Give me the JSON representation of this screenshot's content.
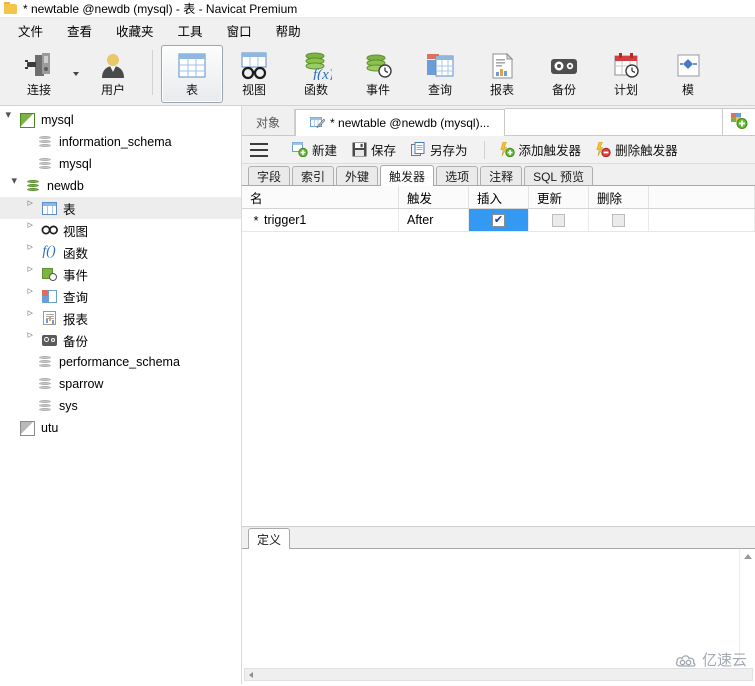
{
  "window": {
    "title": "* newtable @newdb (mysql) - 表 - Navicat Premium",
    "icon": "table-document-icon"
  },
  "menubar": {
    "items": [
      {
        "label": "文件",
        "name": "menu-file"
      },
      {
        "label": "查看",
        "name": "menu-view"
      },
      {
        "label": "收藏夹",
        "name": "menu-favorites"
      },
      {
        "label": "工具",
        "name": "menu-tools"
      },
      {
        "label": "窗口",
        "name": "menu-window"
      },
      {
        "label": "帮助",
        "name": "menu-help"
      }
    ]
  },
  "toolbar": {
    "buttons": [
      {
        "label": "连接",
        "icon": "connection-icon",
        "active": false,
        "has_dropdown": true
      },
      {
        "label": "用户",
        "icon": "user-icon",
        "active": false,
        "has_dropdown": false
      },
      {
        "label": "表",
        "icon": "table-icon",
        "active": true,
        "has_dropdown": false
      },
      {
        "label": "视图",
        "icon": "view-icon",
        "active": false,
        "has_dropdown": false
      },
      {
        "label": "函数",
        "icon": "function-icon",
        "active": false,
        "has_dropdown": false
      },
      {
        "label": "事件",
        "icon": "event-icon",
        "active": false,
        "has_dropdown": false
      },
      {
        "label": "查询",
        "icon": "query-icon",
        "active": false,
        "has_dropdown": false
      },
      {
        "label": "报表",
        "icon": "report-icon",
        "active": false,
        "has_dropdown": false
      },
      {
        "label": "备份",
        "icon": "backup-icon",
        "active": false,
        "has_dropdown": false
      },
      {
        "label": "计划",
        "icon": "schedule-icon",
        "active": false,
        "has_dropdown": false
      },
      {
        "label": "模",
        "icon": "model-icon",
        "active": false,
        "has_dropdown": false
      }
    ]
  },
  "sidebar": {
    "nodes": [
      {
        "label": "mysql",
        "icon": "connection-open-icon",
        "indent": 0,
        "expander": "open",
        "selected": false
      },
      {
        "label": "information_schema",
        "icon": "database-gray-icon",
        "indent": 1,
        "expander": "none",
        "selected": false
      },
      {
        "label": "mysql",
        "icon": "database-gray-icon",
        "indent": 1,
        "expander": "none",
        "selected": false
      },
      {
        "label": "newdb",
        "icon": "database-green-icon",
        "indent": 1,
        "expander": "open",
        "selected": false
      },
      {
        "label": "表",
        "icon": "table-icon",
        "indent": 2,
        "expander": "closed",
        "selected": true
      },
      {
        "label": "视图",
        "icon": "view-icon",
        "indent": 2,
        "expander": "closed",
        "selected": false
      },
      {
        "label": "函数",
        "icon": "function-icon",
        "indent": 2,
        "expander": "closed",
        "selected": false
      },
      {
        "label": "事件",
        "icon": "event-icon",
        "indent": 2,
        "expander": "closed",
        "selected": false
      },
      {
        "label": "查询",
        "icon": "query-icon",
        "indent": 2,
        "expander": "closed",
        "selected": false
      },
      {
        "label": "报表",
        "icon": "report-icon",
        "indent": 2,
        "expander": "closed",
        "selected": false
      },
      {
        "label": "备份",
        "icon": "backup-icon",
        "indent": 2,
        "expander": "closed",
        "selected": false
      },
      {
        "label": "performance_schema",
        "icon": "database-gray-icon",
        "indent": 1,
        "expander": "none",
        "selected": false
      },
      {
        "label": "sparrow",
        "icon": "database-gray-icon",
        "indent": 1,
        "expander": "none",
        "selected": false
      },
      {
        "label": "sys",
        "icon": "database-gray-icon",
        "indent": 1,
        "expander": "none",
        "selected": false
      },
      {
        "label": "utu",
        "icon": "connection-closed-icon",
        "indent": 0,
        "expander": "none",
        "selected": false
      }
    ]
  },
  "doc_tabs": {
    "tabs": [
      {
        "label": "对象",
        "icon": "none",
        "active": false
      },
      {
        "label": "* newtable @newdb (mysql)...",
        "icon": "table-edit-icon",
        "active": true
      }
    ],
    "new_tab_button": {
      "name": "new-tab-button",
      "icon": "new-object-icon"
    }
  },
  "object_toolbar": {
    "menu_button": {
      "label": "",
      "icon": "hamburger-icon"
    },
    "buttons": [
      {
        "label": "新建",
        "icon": "new-icon"
      },
      {
        "label": "保存",
        "icon": "save-icon"
      },
      {
        "label": "另存为",
        "icon": "save-as-icon"
      }
    ],
    "trigger_buttons": [
      {
        "label": "添加触发器",
        "icon": "add-trigger-icon"
      },
      {
        "label": "删除触发器",
        "icon": "delete-trigger-icon"
      }
    ]
  },
  "inner_tabs": {
    "tabs": [
      {
        "label": "字段",
        "active": false
      },
      {
        "label": "索引",
        "active": false
      },
      {
        "label": "外键",
        "active": false
      },
      {
        "label": "触发器",
        "active": true
      },
      {
        "label": "选项",
        "active": false
      },
      {
        "label": "注释",
        "active": false
      },
      {
        "label": "SQL 预览",
        "active": false
      }
    ]
  },
  "trigger_grid": {
    "columns": [
      {
        "label": "名",
        "width": 145
      },
      {
        "label": "触发",
        "width": 70
      },
      {
        "label": "插入",
        "width": 60
      },
      {
        "label": "更新",
        "width": 60
      },
      {
        "label": "删除",
        "width": 60
      }
    ],
    "rows": [
      {
        "marker": "*",
        "name": "trigger1",
        "fire": "After",
        "insert": true,
        "insert_selected": true,
        "update": false,
        "delete": false
      }
    ]
  },
  "definition_pane": {
    "tabs": [
      {
        "label": "定义",
        "active": true
      }
    ],
    "content": ""
  },
  "watermark": {
    "text": "亿速云",
    "icon": "cloud-icon"
  },
  "colors": {
    "accent_blue": "#3399f3",
    "toolbar_bg": "#f0f0f0",
    "tree_selected": "#ededed",
    "green": "#7cb342",
    "red": "#d9443f"
  }
}
